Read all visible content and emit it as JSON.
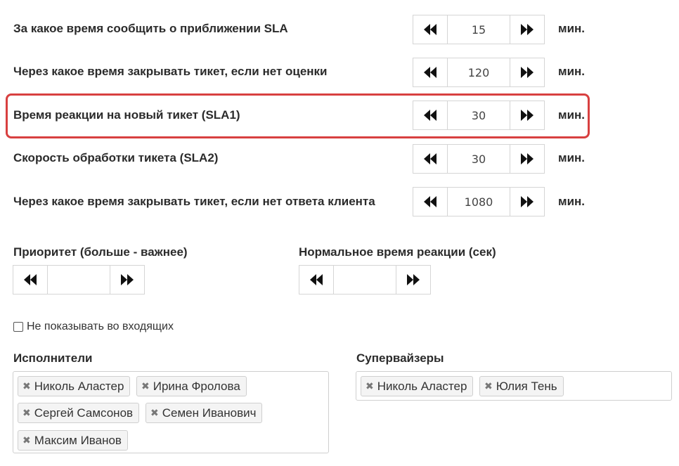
{
  "sla_rows": [
    {
      "label": "За какое время сообщить о приближении SLA",
      "value": "15",
      "unit": "мин."
    },
    {
      "label": "Через какое время закрывать тикет, если нет оценки",
      "value": "120",
      "unit": "мин."
    },
    {
      "label": "Время реакции на новый тикет (SLA1)",
      "value": "30",
      "unit": "мин."
    },
    {
      "label": "Скорость обработки тикета (SLA2)",
      "value": "30",
      "unit": "мин."
    },
    {
      "label": "Через какое время закрывать тикет, если нет ответа клиента",
      "value": "1080",
      "unit": "мин."
    }
  ],
  "priority": {
    "label": "Приоритет (больше - важнее)",
    "value": ""
  },
  "normal_reaction": {
    "label": "Нормальное время реакции (сек)",
    "value": ""
  },
  "hide_incoming": {
    "label": "Не показывать во входящих",
    "checked": false
  },
  "executors": {
    "label": "Исполнители",
    "tags": [
      "Николь Аластер",
      "Ирина Фролова",
      "Сергей Самсонов",
      "Семен Иванович",
      "Максим Иванов"
    ]
  },
  "supervisors": {
    "label": "Супервайзеры",
    "tags": [
      "Николь Аластер",
      "Юлия Тень"
    ]
  },
  "colors": {
    "highlight": "#d84040"
  },
  "icons": {
    "decrement": "double-chevron-left-icon",
    "increment": "double-chevron-right-icon",
    "remove": "remove-x-icon"
  }
}
